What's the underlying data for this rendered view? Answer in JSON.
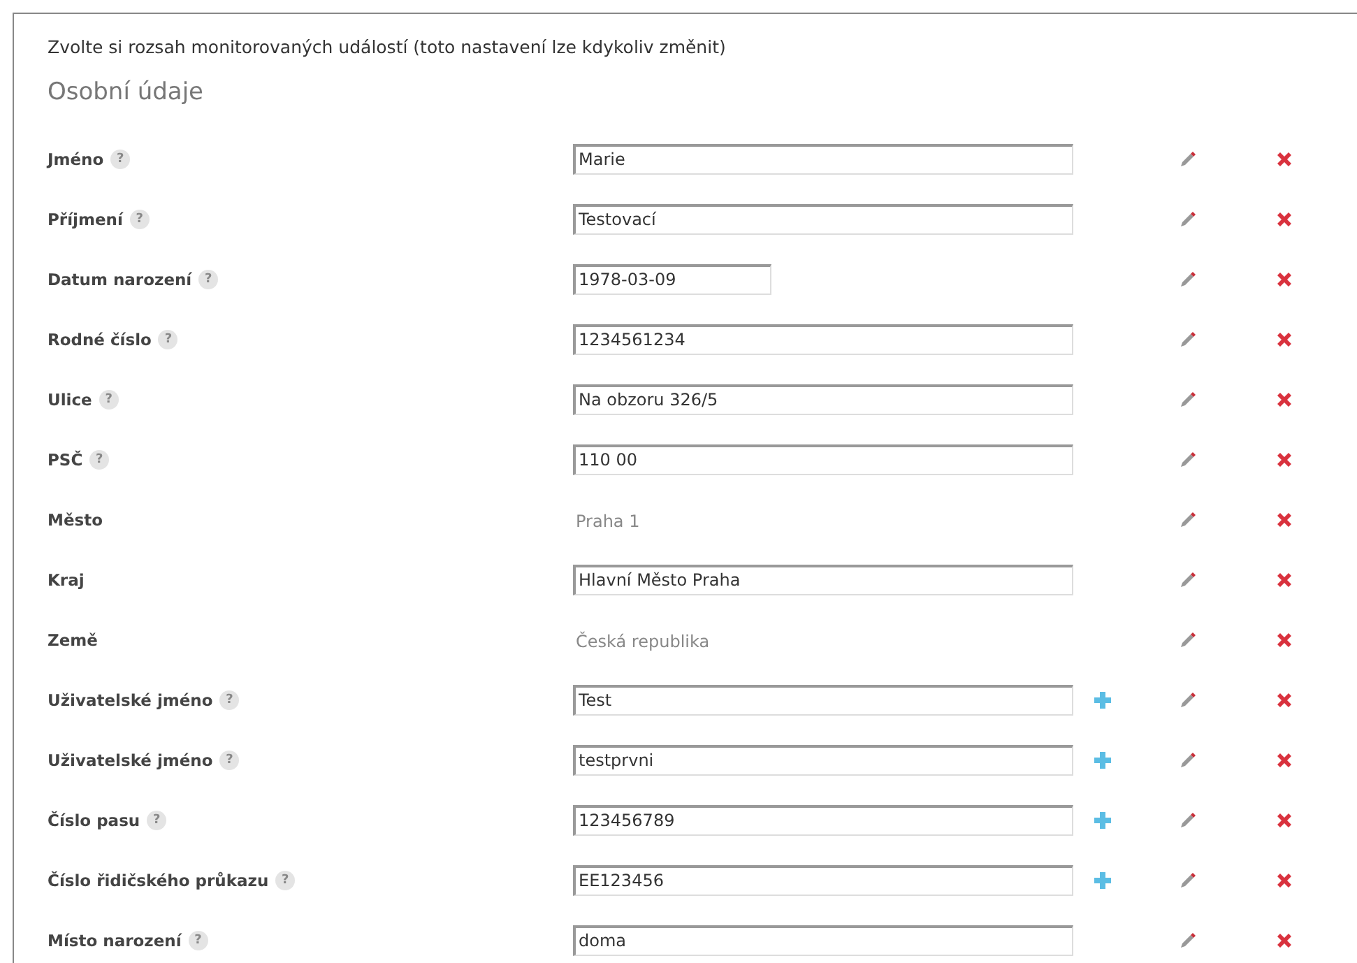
{
  "heading": "Zvolte si rozsah monitorovaných událostí (toto nastavení lze kdykoliv změnit)",
  "section": "Osobní údaje",
  "help_mark": "?",
  "rows": [
    {
      "label": "Jméno",
      "help": true,
      "kind": "input",
      "value": "Marie",
      "addable": false
    },
    {
      "label": "Příjmení",
      "help": true,
      "kind": "input",
      "value": "Testovací",
      "addable": false
    },
    {
      "label": "Datum narození",
      "help": true,
      "kind": "input",
      "value": "1978-03-09",
      "short": true,
      "addable": false
    },
    {
      "label": "Rodné číslo",
      "help": true,
      "kind": "input",
      "value": "1234561234",
      "addable": false
    },
    {
      "label": "Ulice",
      "help": true,
      "kind": "input",
      "value": "Na obzoru 326/5",
      "addable": false
    },
    {
      "label": "PSČ",
      "help": true,
      "kind": "input",
      "value": "110 00",
      "addable": false
    },
    {
      "label": "Město",
      "help": false,
      "kind": "text",
      "value": "Praha 1",
      "addable": false
    },
    {
      "label": "Kraj",
      "help": false,
      "kind": "input",
      "value": "Hlavní Město Praha",
      "addable": false
    },
    {
      "label": "Země",
      "help": false,
      "kind": "text",
      "value": "Česká republika",
      "addable": false
    },
    {
      "label": "Uživatelské jméno",
      "help": true,
      "kind": "input",
      "value": "Test",
      "addable": true
    },
    {
      "label": "Uživatelské jméno",
      "help": true,
      "kind": "input",
      "value": "testprvni",
      "addable": true
    },
    {
      "label": "Číslo pasu",
      "help": true,
      "kind": "input",
      "value": "123456789",
      "addable": true
    },
    {
      "label": "Číslo řidičského průkazu",
      "help": true,
      "kind": "input",
      "value": "EE123456",
      "addable": true
    },
    {
      "label": "Místo narození",
      "help": true,
      "kind": "input",
      "value": "doma",
      "addable": false
    }
  ]
}
